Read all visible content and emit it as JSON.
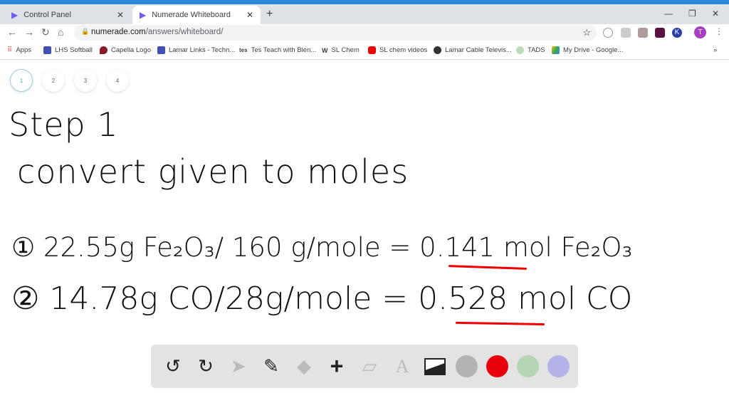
{
  "browser": {
    "tabs": [
      {
        "label": "Control Panel"
      },
      {
        "label": "Numerade Whiteboard",
        "active": true
      }
    ],
    "url_host": "numerade.com",
    "url_path": "/answers/whiteboard/",
    "profile_initial": "T",
    "bookmarks": [
      {
        "label": "Apps"
      },
      {
        "label": "LHS Softball"
      },
      {
        "label": "Capella Logo"
      },
      {
        "label": "Lamar Links - Techn..."
      },
      {
        "label": "Tes Teach with Blen..."
      },
      {
        "label": "SL Chem"
      },
      {
        "label": "SL chem videos"
      },
      {
        "label": "Lamar Cable Televis..."
      },
      {
        "label": "TADS"
      },
      {
        "label": "My Drive - Google..."
      }
    ],
    "more": "»"
  },
  "pages": [
    "1",
    "2",
    "3",
    "4"
  ],
  "whiteboard": {
    "line1": "Step 1",
    "line2": "convert given to moles",
    "line3": "① 22.55g Fe₂O₃/ 160 g/mole = 0.141 mol Fe₂O₃",
    "line4": "② 14.78g CO/28g/mole = 0.528 mol CO"
  },
  "toolbar": {
    "colors": [
      "#b3b3b3",
      "#e8000b",
      "#b5d6b5",
      "#b3b3ea"
    ]
  }
}
